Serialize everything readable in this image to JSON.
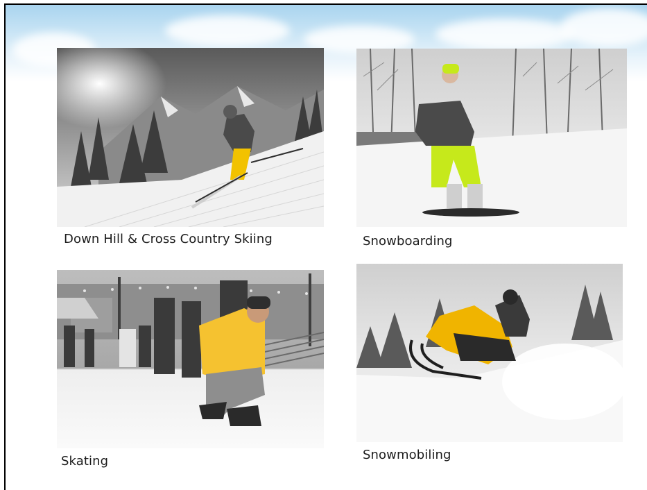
{
  "activities": [
    {
      "caption": "Down Hill & Cross Country Skiing",
      "icon": "skier-photo",
      "accent": "#f2c200"
    },
    {
      "caption": "Snowboarding",
      "icon": "snowboarder-photo",
      "accent": "#c6e91b"
    },
    {
      "caption": "Skating",
      "icon": "skater-photo",
      "accent": "#f5c230"
    },
    {
      "caption": "Snowmobiling",
      "icon": "snowmobile-photo",
      "accent": "#f0b400"
    }
  ]
}
